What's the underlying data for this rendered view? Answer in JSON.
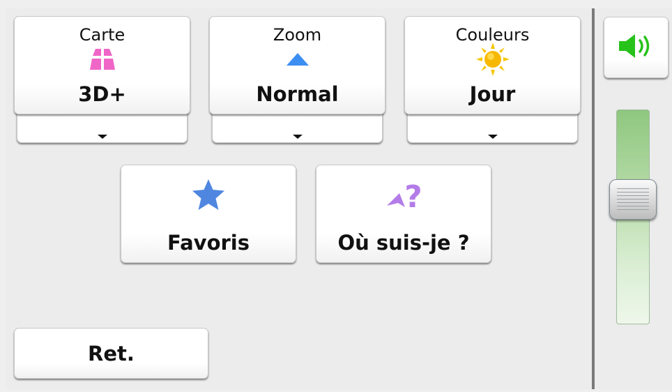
{
  "map_options": [
    {
      "caption": "Carte",
      "value": "3D+",
      "icon": "3d-map-icon",
      "icon_color": "#ef66c7"
    },
    {
      "caption": "Zoom",
      "value": "Normal",
      "icon": "zoom-arrow-icon",
      "icon_color": "#3d8ef2"
    },
    {
      "caption": "Couleurs",
      "value": "Jour",
      "icon": "sun-icon",
      "icon_color": "#f7b800"
    }
  ],
  "actions": [
    {
      "label": "Favoris",
      "icon": "star-icon",
      "icon_color": "#4f87e0"
    },
    {
      "label": "Où suis-je ?",
      "icon": "where-am-i-icon",
      "icon_color": "#b37ce8"
    }
  ],
  "back": {
    "label": "Ret."
  },
  "sound": {
    "icon": "speaker-icon",
    "color": "#27c21a"
  },
  "volume": {
    "level": 0.6
  }
}
